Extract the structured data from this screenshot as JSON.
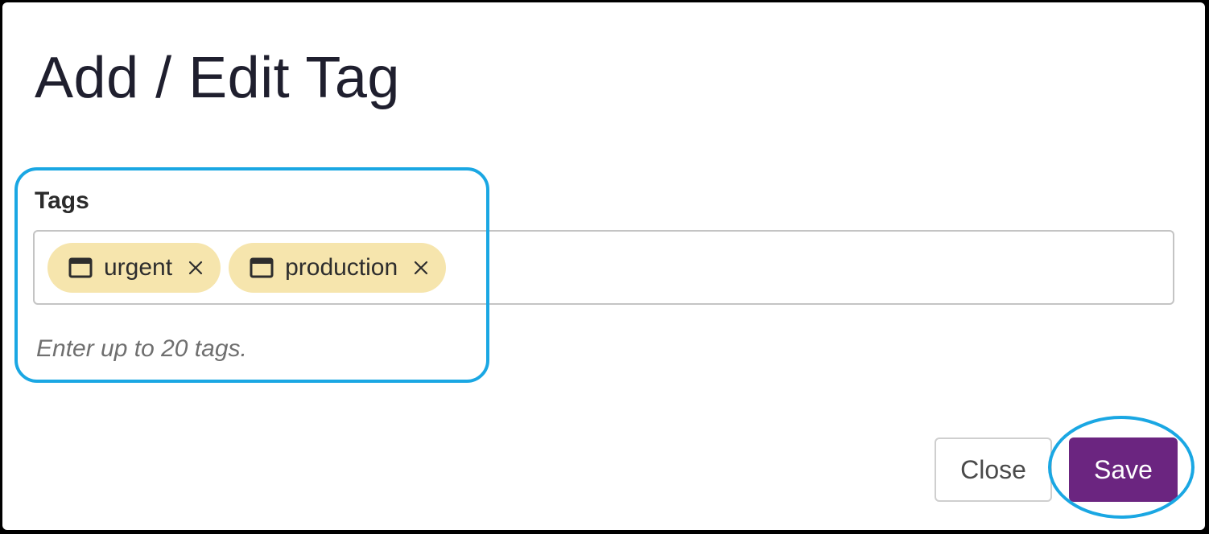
{
  "dialog": {
    "title": "Add / Edit Tag"
  },
  "tags_field": {
    "label": "Tags",
    "tags": [
      {
        "label": "urgent",
        "icon": "window-icon",
        "remove_icon": "close-icon"
      },
      {
        "label": "production",
        "icon": "window-icon",
        "remove_icon": "close-icon"
      }
    ],
    "helper_text": "Enter up to 20 tags."
  },
  "footer": {
    "close_label": "Close",
    "save_label": "Save"
  },
  "colors": {
    "tag_background": "#f6e5ad",
    "save_button": "#6b2580",
    "highlight": "#1aa7e3"
  }
}
